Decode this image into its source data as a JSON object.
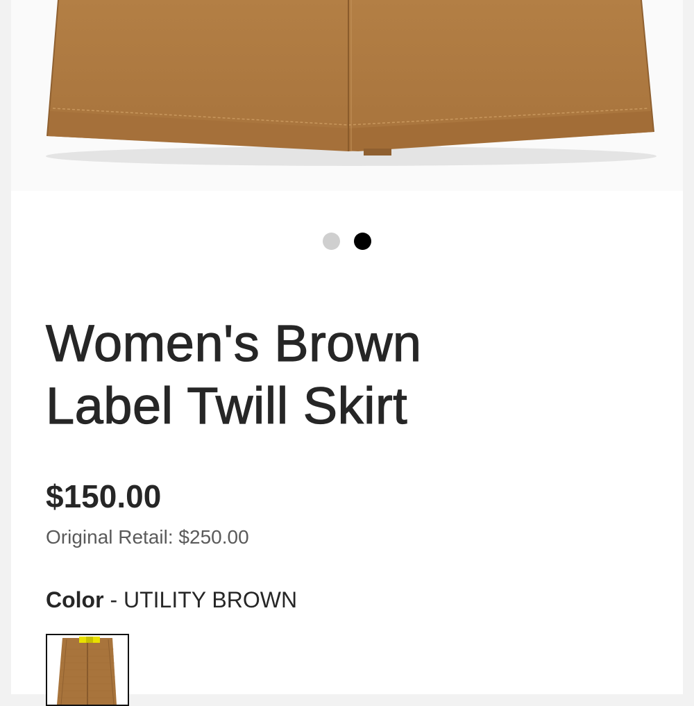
{
  "carousel": {
    "slide_count": 2,
    "active_index": 1,
    "image_alt": "Brown twill skirt hem"
  },
  "product": {
    "title_line1": "Women's Brown",
    "title_line2": "Label Twill Skirt",
    "price": "$150.00",
    "original_retail_label": "Original Retail:",
    "original_retail_value": "$250.00",
    "color_label": "Color",
    "color_separator": " - ",
    "color_value": "UTILITY BROWN"
  },
  "colors": {
    "fabric": "#b07c43",
    "fabric_dark": "#8f6030",
    "accent_yellow": "#e8e000",
    "dot_active": "#000000",
    "dot_inactive": "#cfcfcf"
  }
}
